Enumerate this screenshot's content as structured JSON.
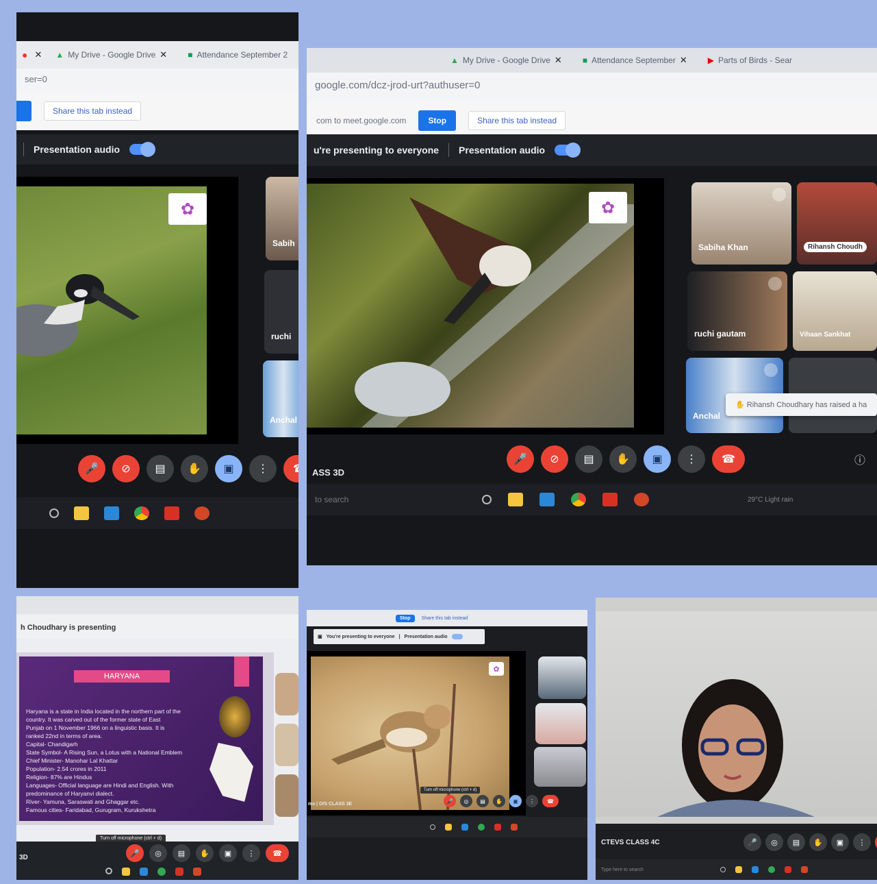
{
  "panel1": {
    "tabs": [
      {
        "icon": "drive-icon",
        "label": "My Drive - Google Drive"
      },
      {
        "icon": "sheets-icon",
        "label": "Attendance September 2"
      }
    ],
    "url_fragment": "ser=0",
    "share_link": "Share this tab instead",
    "presentation_audio": "Presentation audio",
    "tile_names": [
      "Sabih",
      "ruchi",
      "Anchal"
    ]
  },
  "panel2": {
    "tabs": [
      {
        "icon": "drive-icon",
        "label": "My Drive - Google Drive"
      },
      {
        "icon": "sheets-icon",
        "label": "Attendance September"
      },
      {
        "icon": "youtube-icon",
        "label": "Parts of Birds - Sear"
      }
    ],
    "url": "google.com/dcz-jrod-urt?authuser=0",
    "sharing_text": "com to meet.google.com",
    "stop_label": "Stop",
    "share_link": "Share this tab instead",
    "presenting_text": "u're presenting to everyone",
    "presentation_audio": "Presentation audio",
    "tile_names": [
      "Sabiha Khan",
      "Rihansh Choudh",
      "ruchi gautam",
      "Vihaan Sankhat",
      "Anchal"
    ],
    "toast": "Rihansh Choudhary has raised a ha",
    "meeting_label": "ASS 3D",
    "search_text": "to search",
    "weather": "29°C  Light rain"
  },
  "panel3": {
    "presenting_text": "h Choudhary is presenting",
    "slide_title": "HARYANA",
    "slide_lines": [
      "Haryana is a state in India located in the northern part of the",
      "country. It was carved out of the former state of East",
      "Punjab on 1 November 1966 on a linguistic basis. It is",
      "ranked 22nd in terms of area.",
      "Capital- Chandigarh",
      "State Symbol- A Rising Sun, a Lotus with a National Emblem",
      "Chief Minister- Manohar Lal Khattar",
      "Population- 2.54 crores in 2011",
      "Religion- 87% are Hindus",
      "Languages- Official language are Hindi and English. With",
      "predominance of Haryanvi dialect.",
      "River- Yamuna, Saraswati and Ghaggar etc.",
      "Famous cities- Faridabad, Gurugram, Kurukshetra"
    ],
    "tooltip": "Turn off microphone (ctrl + d)",
    "meeting_label": "3D"
  },
  "panel4": {
    "stop_label": "Stop",
    "share_link": "Share this tab instead",
    "presenting_text": "You're presenting to everyone",
    "presentation_audio": "Presentation audio",
    "tooltip": "Turn off microphone (ctrl + d)",
    "meeting_label": "ms  |  O/S CLASS 3E"
  },
  "panel5": {
    "meeting_label": "CTEVS CLASS 4C",
    "search_text": "Type here to search"
  },
  "colors": {
    "background": "#9fb4e6",
    "meet_red": "#ea4335",
    "meet_blue": "#8ab4f8",
    "stop_blue": "#1a73e8",
    "slide_purple": "#4a1e6e",
    "slide_pink": "#e34a87"
  }
}
